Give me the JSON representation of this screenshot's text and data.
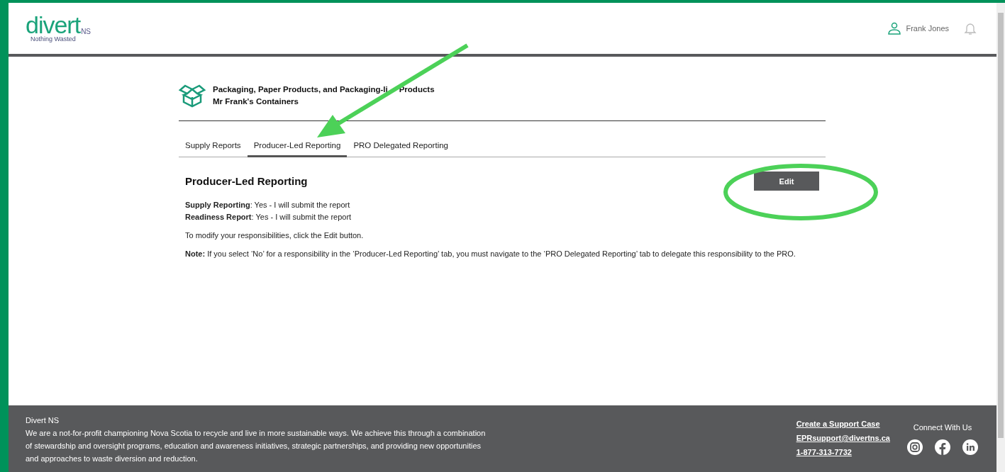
{
  "header": {
    "logo": {
      "wordmark": "divert",
      "suffix": "NS",
      "tagline": "Nothing Wasted"
    },
    "user": "Frank Jones"
  },
  "program": {
    "title_parts": [
      "Packaging, Paper Products, and Packaging-li",
      "Products"
    ],
    "company": "Mr Frank's Containers"
  },
  "tabs": [
    {
      "label": "Supply Reports",
      "selected": false
    },
    {
      "label": "Producer-Led Reporting",
      "selected": true
    },
    {
      "label": "PRO Delegated Reporting",
      "selected": false
    }
  ],
  "section": {
    "title": "Producer-Led Reporting",
    "edit_button": "Edit",
    "fields": [
      "**Supply Reporting**:  Yes - I will submit the report",
      "**Readiness Report**:  Yes - I will submit the report"
    ],
    "instruction": "To modify your responsibilities, click the Edit button.",
    "note": "**Note:** If you select ‘No’ for a responsibility in the ‘Producer-Led Reporting’ tab, you must navigate to the ‘PRO Delegated Reporting’ tab to delegate this responsibility to the PRO."
  },
  "footer": {
    "org": "Divert NS",
    "about": "We are a not-for-profit championing Nova Scotia to recycle and live in more sustainable ways. We achieve this through a combination of stewardship and oversight programs, education and awareness initiatives, strategic partnerships, and providing new opportunities and approaches to waste diversion and reduction.",
    "links": [
      "Create a Support Case",
      "EPRsupport@divertns.ca",
      "1-877-313-7732"
    ],
    "social_heading": "Connect With Us"
  }
}
